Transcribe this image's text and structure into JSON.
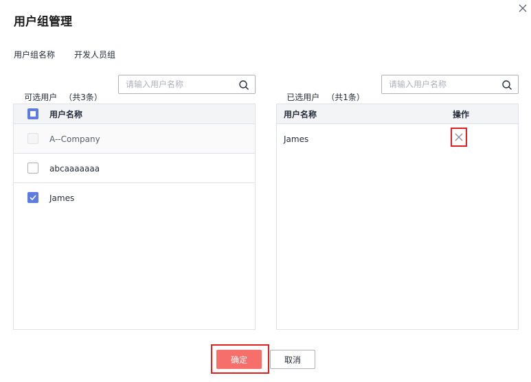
{
  "dialog": {
    "title": "用户组管理",
    "group_name_label": "用户组名称",
    "group_name_value": "开发人员组"
  },
  "available": {
    "caption": "可选用户",
    "count": "（共3条）",
    "search_placeholder": "请输入用户名称",
    "column_username": "用户名称",
    "rows": [
      {
        "name": "A--Company",
        "state": "disabled"
      },
      {
        "name": "abcaaaaaaa",
        "state": "unchecked"
      },
      {
        "name": "James",
        "state": "checked"
      }
    ]
  },
  "selected": {
    "caption": "已选用户",
    "count": "（共1条）",
    "search_placeholder": "请输入用户名称",
    "column_username": "用户名称",
    "column_action": "操作",
    "rows": [
      {
        "name": "James"
      }
    ]
  },
  "footer": {
    "confirm_label": "确定",
    "cancel_label": "取消"
  },
  "colors": {
    "accent": "#5e7ce0",
    "confirm": "#f66f6a",
    "highlight": "#e02020"
  },
  "icons": {
    "close": "close-icon",
    "search": "search-icon",
    "check": "check-icon",
    "remove": "remove-icon"
  }
}
